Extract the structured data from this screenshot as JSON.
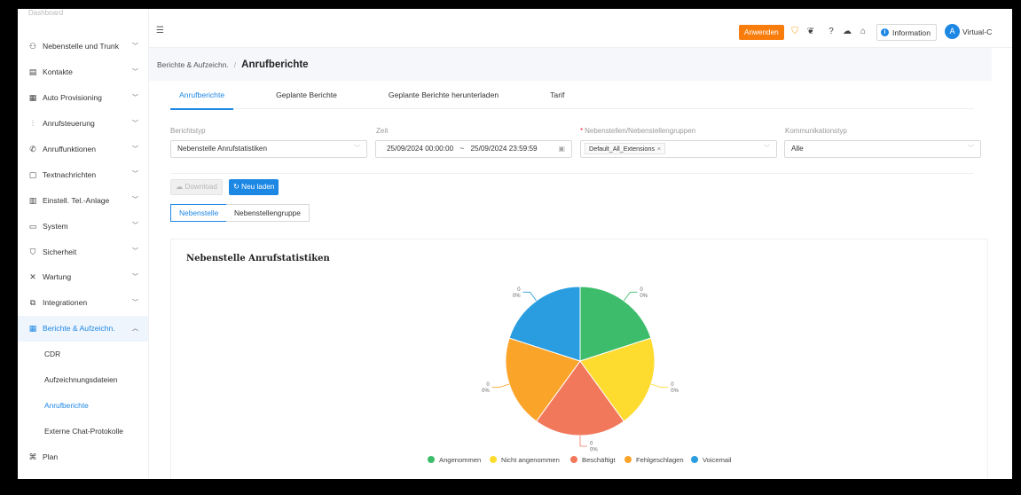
{
  "sidebar": {
    "faded_top": "Dashboard",
    "items": [
      {
        "label": "Nebenstelle und Trunk",
        "icon": "user-group-icon"
      },
      {
        "label": "Kontakte",
        "icon": "contacts-icon"
      },
      {
        "label": "Auto Provisioning",
        "icon": "provisioning-icon"
      },
      {
        "label": "Anrufsteuerung",
        "icon": "call-control-icon"
      },
      {
        "label": "Anruffunktionen",
        "icon": "phone-icon"
      },
      {
        "label": "Textnachrichten",
        "icon": "message-icon"
      },
      {
        "label": "Einstell. Tel.-Anlage",
        "icon": "settings-list-icon"
      },
      {
        "label": "System",
        "icon": "system-icon"
      },
      {
        "label": "Sicherheit",
        "icon": "shield-icon"
      },
      {
        "label": "Wartung",
        "icon": "tools-icon"
      },
      {
        "label": "Integrationen",
        "icon": "integration-icon"
      },
      {
        "label": "Berichte & Aufzeichn.",
        "icon": "report-icon"
      }
    ],
    "sub_items": [
      "CDR",
      "Aufzeichnungsdateien",
      "Anrufberichte",
      "Externe Chat-Protokolle"
    ],
    "bottom_item": {
      "label": "Plan",
      "icon": "plan-icon"
    }
  },
  "header": {
    "apply_label": "Anwenden",
    "info_label": "Information",
    "user_name": "Virtual-C",
    "avatar_letter": "A"
  },
  "breadcrumb": {
    "parent": "Berichte & Aufzeichn.",
    "separator": "/",
    "title": "Anrufberichte"
  },
  "tabs": [
    "Anrufberichte",
    "Geplante Berichte",
    "Geplante Berichte herunterladen",
    "Tarif"
  ],
  "filters": {
    "report_type": {
      "label": "Berichtstyp",
      "value": "Nebenstelle Anrufstatistiken"
    },
    "time": {
      "label": "Zeit",
      "start": "25/09/2024 00:00:00",
      "separator": "~",
      "end": "25/09/2024 23:59:59"
    },
    "extensions": {
      "required_mark": "*",
      "label": "Nebenstellen/Nebenstellengruppen",
      "tag": "Default_All_Extensions"
    },
    "comm_type": {
      "label": "Kommunikationstyp",
      "value": "Alle"
    }
  },
  "actions": {
    "download_label": "Download",
    "reload_label": "Neu laden"
  },
  "segments": [
    "Nebenstelle",
    "Nebenstellengruppe"
  ],
  "colors": {
    "accent": "#1d87e4",
    "apply": "#f97d0d",
    "angenommen": "#3dbd6b",
    "nicht_angenommen": "#fddb2f",
    "beschaeftigt": "#f2785c",
    "fehlgeschlagen": "#fba42a",
    "voicemail": "#2a9de0"
  },
  "chart_data": {
    "type": "pie",
    "title": "Nebenstelle Anrufstatistiken",
    "categories": [
      "Angenommen",
      "Nicht angenommen",
      "Beschäftigt",
      "Fehlgeschlagen",
      "Voicemail"
    ],
    "values": [
      0,
      0,
      0,
      0,
      0
    ],
    "slice_labels": [
      {
        "count": "0",
        "percent": "0%"
      },
      {
        "count": "0",
        "percent": "0%"
      },
      {
        "count": "0",
        "percent": "0%"
      },
      {
        "count": "0",
        "percent": "0%"
      },
      {
        "count": "0",
        "percent": "0%"
      }
    ],
    "legend_position": "bottom"
  }
}
